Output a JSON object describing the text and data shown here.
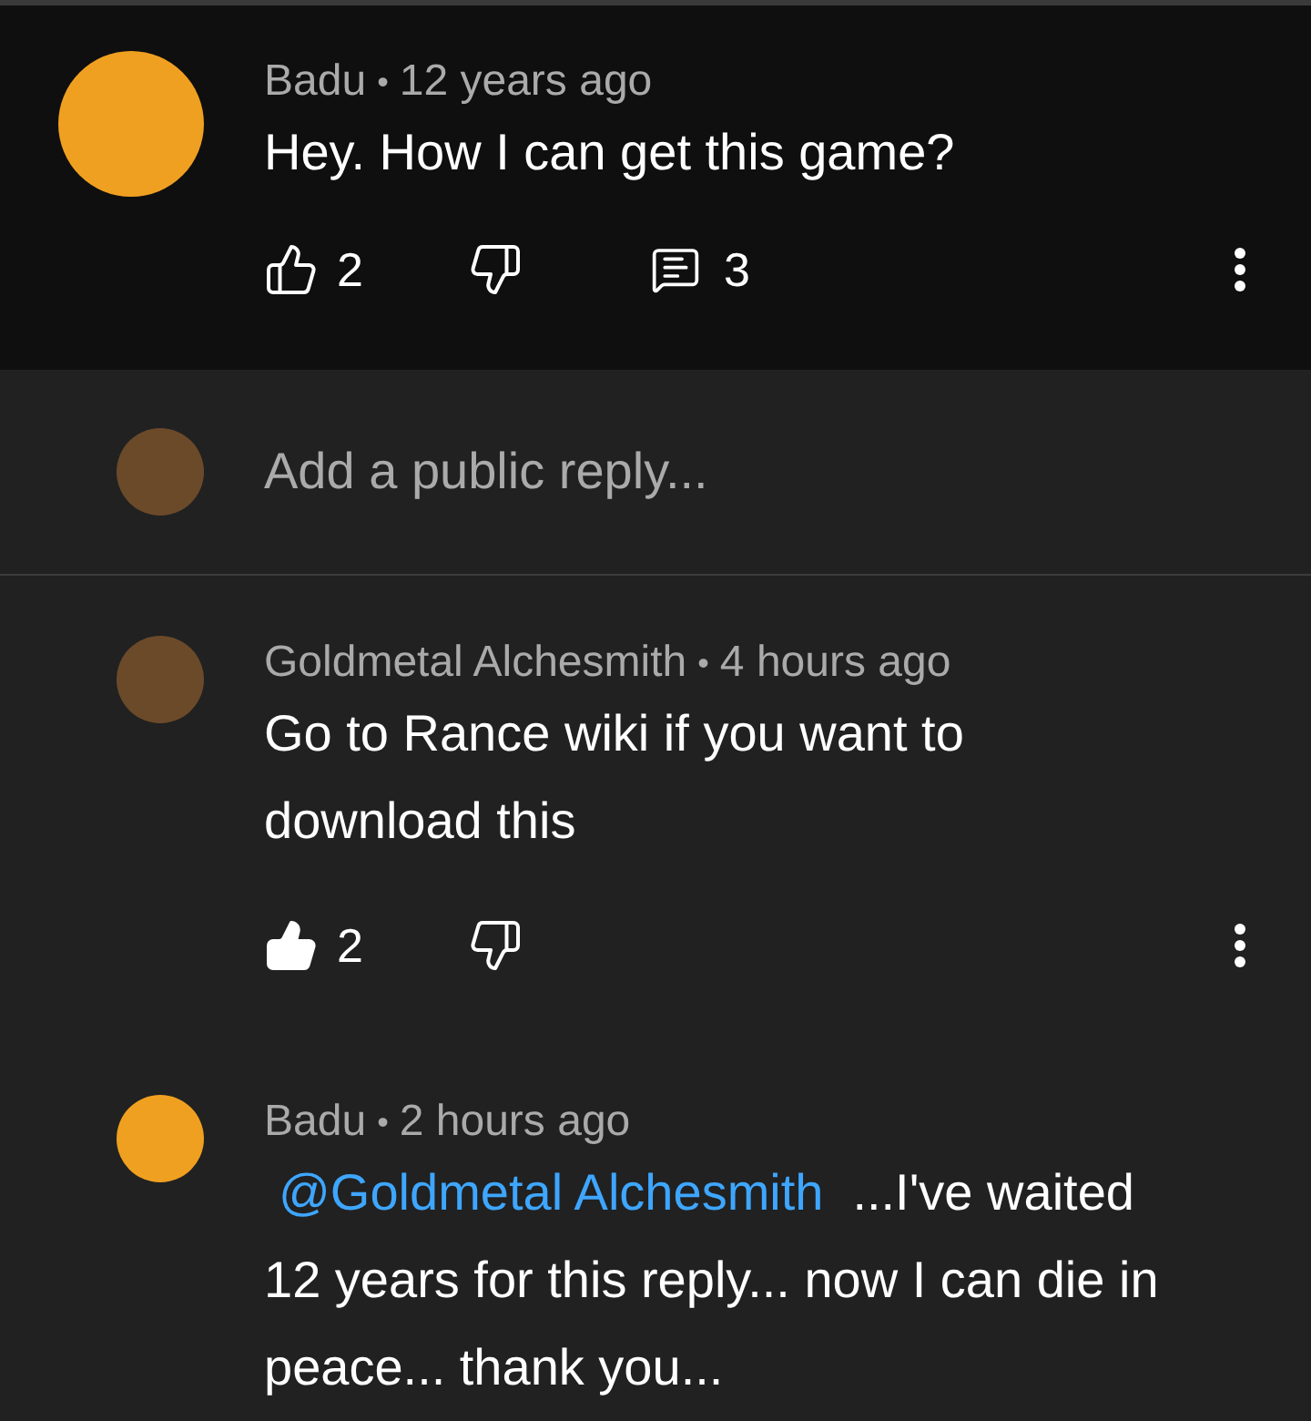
{
  "comment": {
    "author": "Badu",
    "separator": "•",
    "time": "12 years ago",
    "text": "Hey. How I can get this game?",
    "likes": "2",
    "liked": false,
    "disliked": false,
    "replies": "3"
  },
  "reply_box": {
    "placeholder": "Add a public reply..."
  },
  "replies": [
    {
      "author": "Goldmetal Alchesmith",
      "separator": "•",
      "time": "4 hours ago",
      "text": "Go to Rance wiki if you want to download this",
      "likes": "2",
      "liked": true,
      "disliked": false
    },
    {
      "author": "Badu",
      "separator": "•",
      "time": "2 hours ago",
      "mention": "@Goldmetal Alchesmith",
      "text": "...I've waited 12 years for this reply... now I can die in peace... thank you..."
    }
  ]
}
